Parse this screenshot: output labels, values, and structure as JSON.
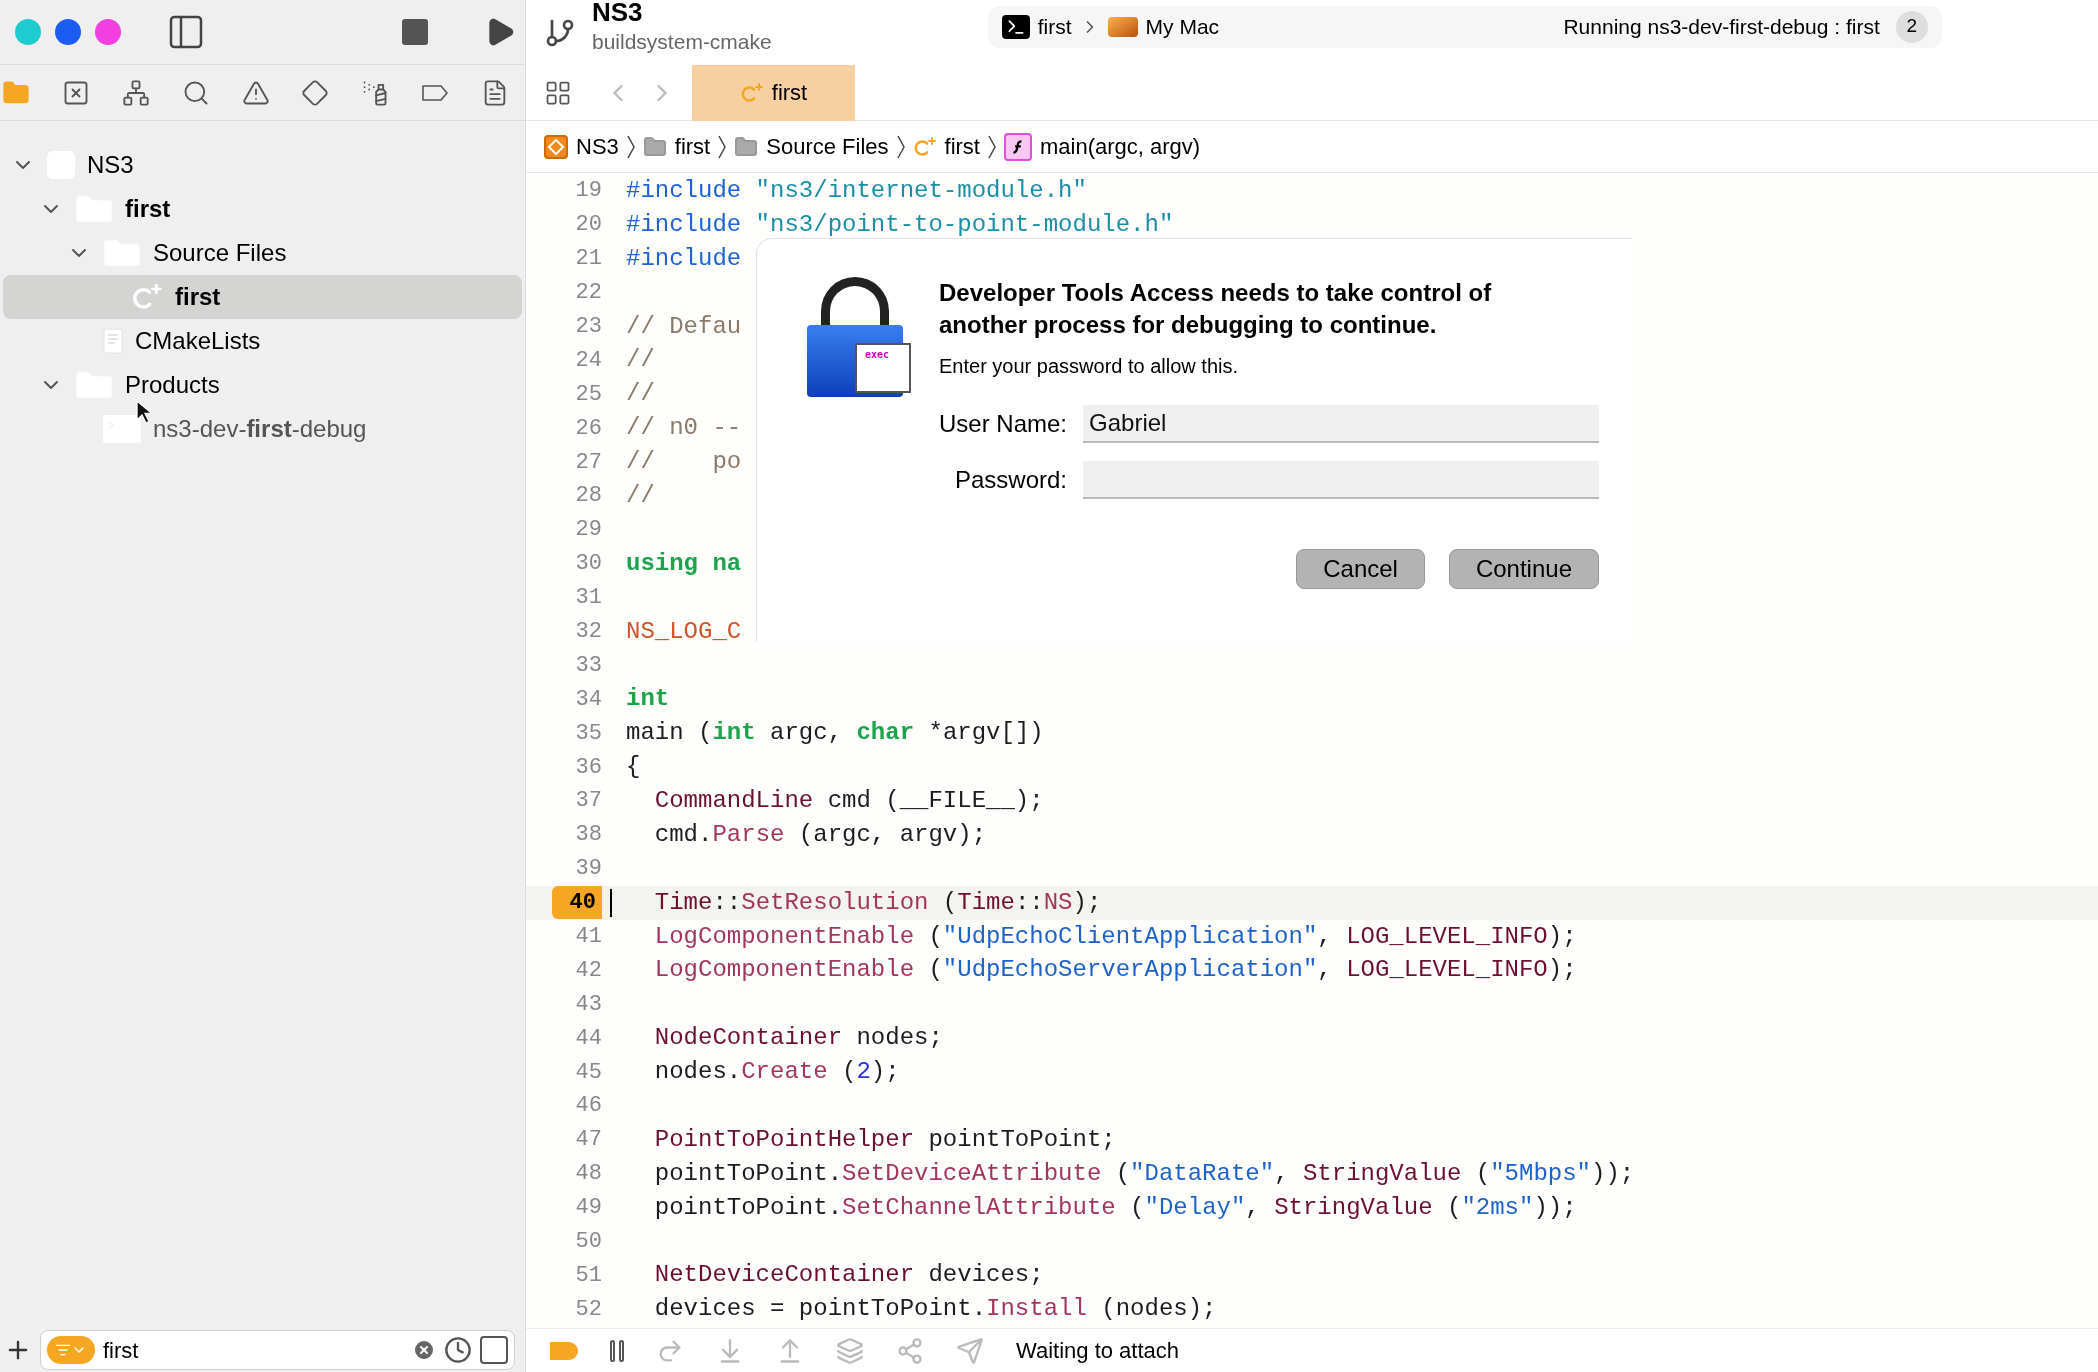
{
  "window": {
    "traffic_lights": [
      {
        "color": "#1ecbcf"
      },
      {
        "color": "#1b5cf2"
      },
      {
        "color": "#f23fe0"
      }
    ]
  },
  "toolbar": {
    "project": "NS3",
    "branch": "buildsystem-cmake",
    "scheme": "first",
    "destination": "My Mac",
    "status": "Running ns3-dev-first-debug : first",
    "badge": "2"
  },
  "navigator": {
    "tabs": [
      {
        "kind": "folder",
        "selected": true
      },
      {
        "kind": "source-control",
        "selected": false
      },
      {
        "kind": "hierarchy",
        "selected": false
      },
      {
        "kind": "search",
        "selected": false
      },
      {
        "kind": "issue",
        "selected": false
      },
      {
        "kind": "test",
        "selected": false
      },
      {
        "kind": "debug",
        "selected": false
      },
      {
        "kind": "breakpoint",
        "selected": false
      },
      {
        "kind": "report",
        "selected": false
      }
    ],
    "tree": [
      {
        "label": "NS3",
        "kind": "project",
        "expanded": true,
        "selected": false,
        "highlighted": false,
        "children": [
          {
            "label": "first",
            "kind": "folder",
            "expanded": true,
            "selected": false,
            "highlighted": true,
            "children": [
              {
                "label": "Source Files",
                "kind": "folder",
                "expanded": true,
                "selected": false,
                "highlighted": false,
                "children": [
                  {
                    "label": "first",
                    "kind": "source",
                    "selected": true,
                    "highlighted": true
                  }
                ]
              },
              {
                "label": "CMakeLists",
                "kind": "text",
                "selected": false,
                "highlighted": false
              }
            ]
          },
          {
            "label": "Products",
            "kind": "folder",
            "expanded": true,
            "selected": false,
            "highlighted": false,
            "children": [
              {
                "label": "ns3-dev-**first**-debug",
                "kind": "executable",
                "selected": false,
                "highlighted": false,
                "dimmed": true
              }
            ]
          }
        ]
      }
    ],
    "filter": {
      "value": "first"
    }
  },
  "editor": {
    "tab": {
      "label": "first",
      "selected": true
    },
    "breadcrumb": [
      {
        "kind": "project",
        "label": "NS3"
      },
      {
        "kind": "folder",
        "label": "first"
      },
      {
        "kind": "folder",
        "label": "Source Files"
      },
      {
        "kind": "source",
        "label": "first"
      },
      {
        "kind": "function",
        "label": "main(argc, argv)"
      }
    ],
    "lines": [
      {
        "number": "19",
        "tokens": [
          {
            "kind": "preproc",
            "text": "#include"
          },
          {
            "kind": "include",
            "text": " \"ns3/internet-module.h\""
          }
        ]
      },
      {
        "number": "20",
        "tokens": [
          {
            "kind": "preproc",
            "text": "#include"
          },
          {
            "kind": "include",
            "text": " \"ns3/point-to-point-module.h\""
          }
        ]
      },
      {
        "number": "21",
        "tokens": [
          {
            "kind": "preproc",
            "text": "#include"
          }
        ]
      },
      {
        "number": "22"
      },
      {
        "number": "23",
        "tokens": [
          {
            "kind": "comment",
            "text": "// Defau"
          }
        ]
      },
      {
        "number": "24",
        "tokens": [
          {
            "kind": "comment",
            "text": "//"
          }
        ]
      },
      {
        "number": "25",
        "tokens": [
          {
            "kind": "comment",
            "text": "//"
          }
        ]
      },
      {
        "number": "26",
        "tokens": [
          {
            "kind": "comment",
            "text": "// n0 --"
          }
        ]
      },
      {
        "number": "27",
        "tokens": [
          {
            "kind": "comment",
            "text": "//    po"
          }
        ]
      },
      {
        "number": "28",
        "tokens": [
          {
            "kind": "comment",
            "text": "//"
          }
        ]
      },
      {
        "number": "29"
      },
      {
        "number": "30",
        "tokens": [
          {
            "kind": "keyword",
            "text": "using na"
          }
        ]
      },
      {
        "number": "31"
      },
      {
        "number": "32",
        "tokens": [
          {
            "kind": "macro",
            "text": "NS_LOG_C"
          }
        ]
      },
      {
        "number": "33"
      },
      {
        "number": "34",
        "tokens": [
          {
            "kind": "keyword",
            "text": "int"
          }
        ]
      },
      {
        "number": "35",
        "tokens": [
          {
            "kind": "plain",
            "text": "main ("
          },
          {
            "kind": "keyword",
            "text": "int"
          },
          {
            "kind": "plain",
            "text": " argc, "
          },
          {
            "kind": "keyword",
            "text": "char"
          },
          {
            "kind": "plain",
            "text": " *argv[])"
          }
        ]
      },
      {
        "number": "36",
        "tokens": [
          {
            "kind": "plain",
            "text": "{"
          }
        ]
      },
      {
        "number": "37",
        "tokens": [
          {
            "kind": "type",
            "text": "  CommandLine"
          },
          {
            "kind": "plain",
            "text": " cmd (__FILE__);"
          }
        ]
      },
      {
        "number": "38",
        "tokens": [
          {
            "kind": "plain",
            "text": "  cmd."
          },
          {
            "kind": "func",
            "text": "Parse"
          },
          {
            "kind": "plain",
            "text": " (argc, argv);"
          }
        ]
      },
      {
        "number": "39"
      },
      {
        "number": "40",
        "current": true,
        "tokens": [
          {
            "kind": "type",
            "text": "  Time"
          },
          {
            "kind": "plain",
            "text": "::"
          },
          {
            "kind": "func",
            "text": "SetResolution"
          },
          {
            "kind": "plain",
            "text": " ("
          },
          {
            "kind": "type",
            "text": "Time"
          },
          {
            "kind": "plain",
            "text": "::"
          },
          {
            "kind": "func",
            "text": "NS"
          },
          {
            "kind": "plain",
            "text": ");"
          }
        ]
      },
      {
        "number": "41",
        "tokens": [
          {
            "kind": "func",
            "text": "  LogComponentEnable"
          },
          {
            "kind": "plain",
            "text": " ("
          },
          {
            "kind": "string",
            "text": "\"UdpEchoClientApplication\""
          },
          {
            "kind": "plain",
            "text": ", "
          },
          {
            "kind": "type",
            "text": "LOG_LEVEL_INFO"
          },
          {
            "kind": "plain",
            "text": ");"
          }
        ]
      },
      {
        "number": "42",
        "tokens": [
          {
            "kind": "func",
            "text": "  LogComponentEnable"
          },
          {
            "kind": "plain",
            "text": " ("
          },
          {
            "kind": "string",
            "text": "\"UdpEchoServerApplication\""
          },
          {
            "kind": "plain",
            "text": ", "
          },
          {
            "kind": "type",
            "text": "LOG_LEVEL_INFO"
          },
          {
            "kind": "plain",
            "text": ");"
          }
        ]
      },
      {
        "number": "43"
      },
      {
        "number": "44",
        "tokens": [
          {
            "kind": "type",
            "text": "  NodeContainer"
          },
          {
            "kind": "plain",
            "text": " nodes;"
          }
        ]
      },
      {
        "number": "45",
        "tokens": [
          {
            "kind": "plain",
            "text": "  nodes."
          },
          {
            "kind": "func",
            "text": "Create"
          },
          {
            "kind": "plain",
            "text": " ("
          },
          {
            "kind": "number",
            "text": "2"
          },
          {
            "kind": "plain",
            "text": ");"
          }
        ]
      },
      {
        "number": "46"
      },
      {
        "number": "47",
        "tokens": [
          {
            "kind": "type",
            "text": "  PointToPointHelper"
          },
          {
            "kind": "plain",
            "text": " pointToPoint;"
          }
        ]
      },
      {
        "number": "48",
        "tokens": [
          {
            "kind": "plain",
            "text": "  pointToPoint."
          },
          {
            "kind": "func",
            "text": "SetDeviceAttribute"
          },
          {
            "kind": "plain",
            "text": " ("
          },
          {
            "kind": "string",
            "text": "\"DataRate\""
          },
          {
            "kind": "plain",
            "text": ", "
          },
          {
            "kind": "type",
            "text": "StringValue"
          },
          {
            "kind": "plain",
            "text": " ("
          },
          {
            "kind": "string",
            "text": "\"5Mbps\""
          },
          {
            "kind": "plain",
            "text": "));"
          }
        ]
      },
      {
        "number": "49",
        "tokens": [
          {
            "kind": "plain",
            "text": "  pointToPoint."
          },
          {
            "kind": "func",
            "text": "SetChannelAttribute"
          },
          {
            "kind": "plain",
            "text": " ("
          },
          {
            "kind": "string",
            "text": "\"Delay\""
          },
          {
            "kind": "plain",
            "text": ", "
          },
          {
            "kind": "type",
            "text": "StringValue"
          },
          {
            "kind": "plain",
            "text": " ("
          },
          {
            "kind": "string",
            "text": "\"2ms\""
          },
          {
            "kind": "plain",
            "text": "));"
          }
        ]
      },
      {
        "number": "50"
      },
      {
        "number": "51",
        "tokens": [
          {
            "kind": "type",
            "text": "  NetDeviceContainer"
          },
          {
            "kind": "plain",
            "text": " devices;"
          }
        ]
      },
      {
        "number": "52",
        "tokens": [
          {
            "kind": "plain",
            "text": "  devices = pointToPoint."
          },
          {
            "kind": "func",
            "text": "Install"
          },
          {
            "kind": "plain",
            "text": " (nodes);"
          }
        ]
      }
    ]
  },
  "debug_bar": {
    "breakpoints_on": true,
    "status": "Waiting to attach"
  },
  "dialog": {
    "icon_label": "exec",
    "title": "Developer Tools Access needs to take control of another process for debugging to continue.",
    "message": "Enter your password to allow this.",
    "fields": [
      {
        "label": "User Name:",
        "value": "Gabriel"
      },
      {
        "label": "Password:"
      }
    ],
    "buttons": [
      "Cancel",
      "Continue"
    ]
  }
}
